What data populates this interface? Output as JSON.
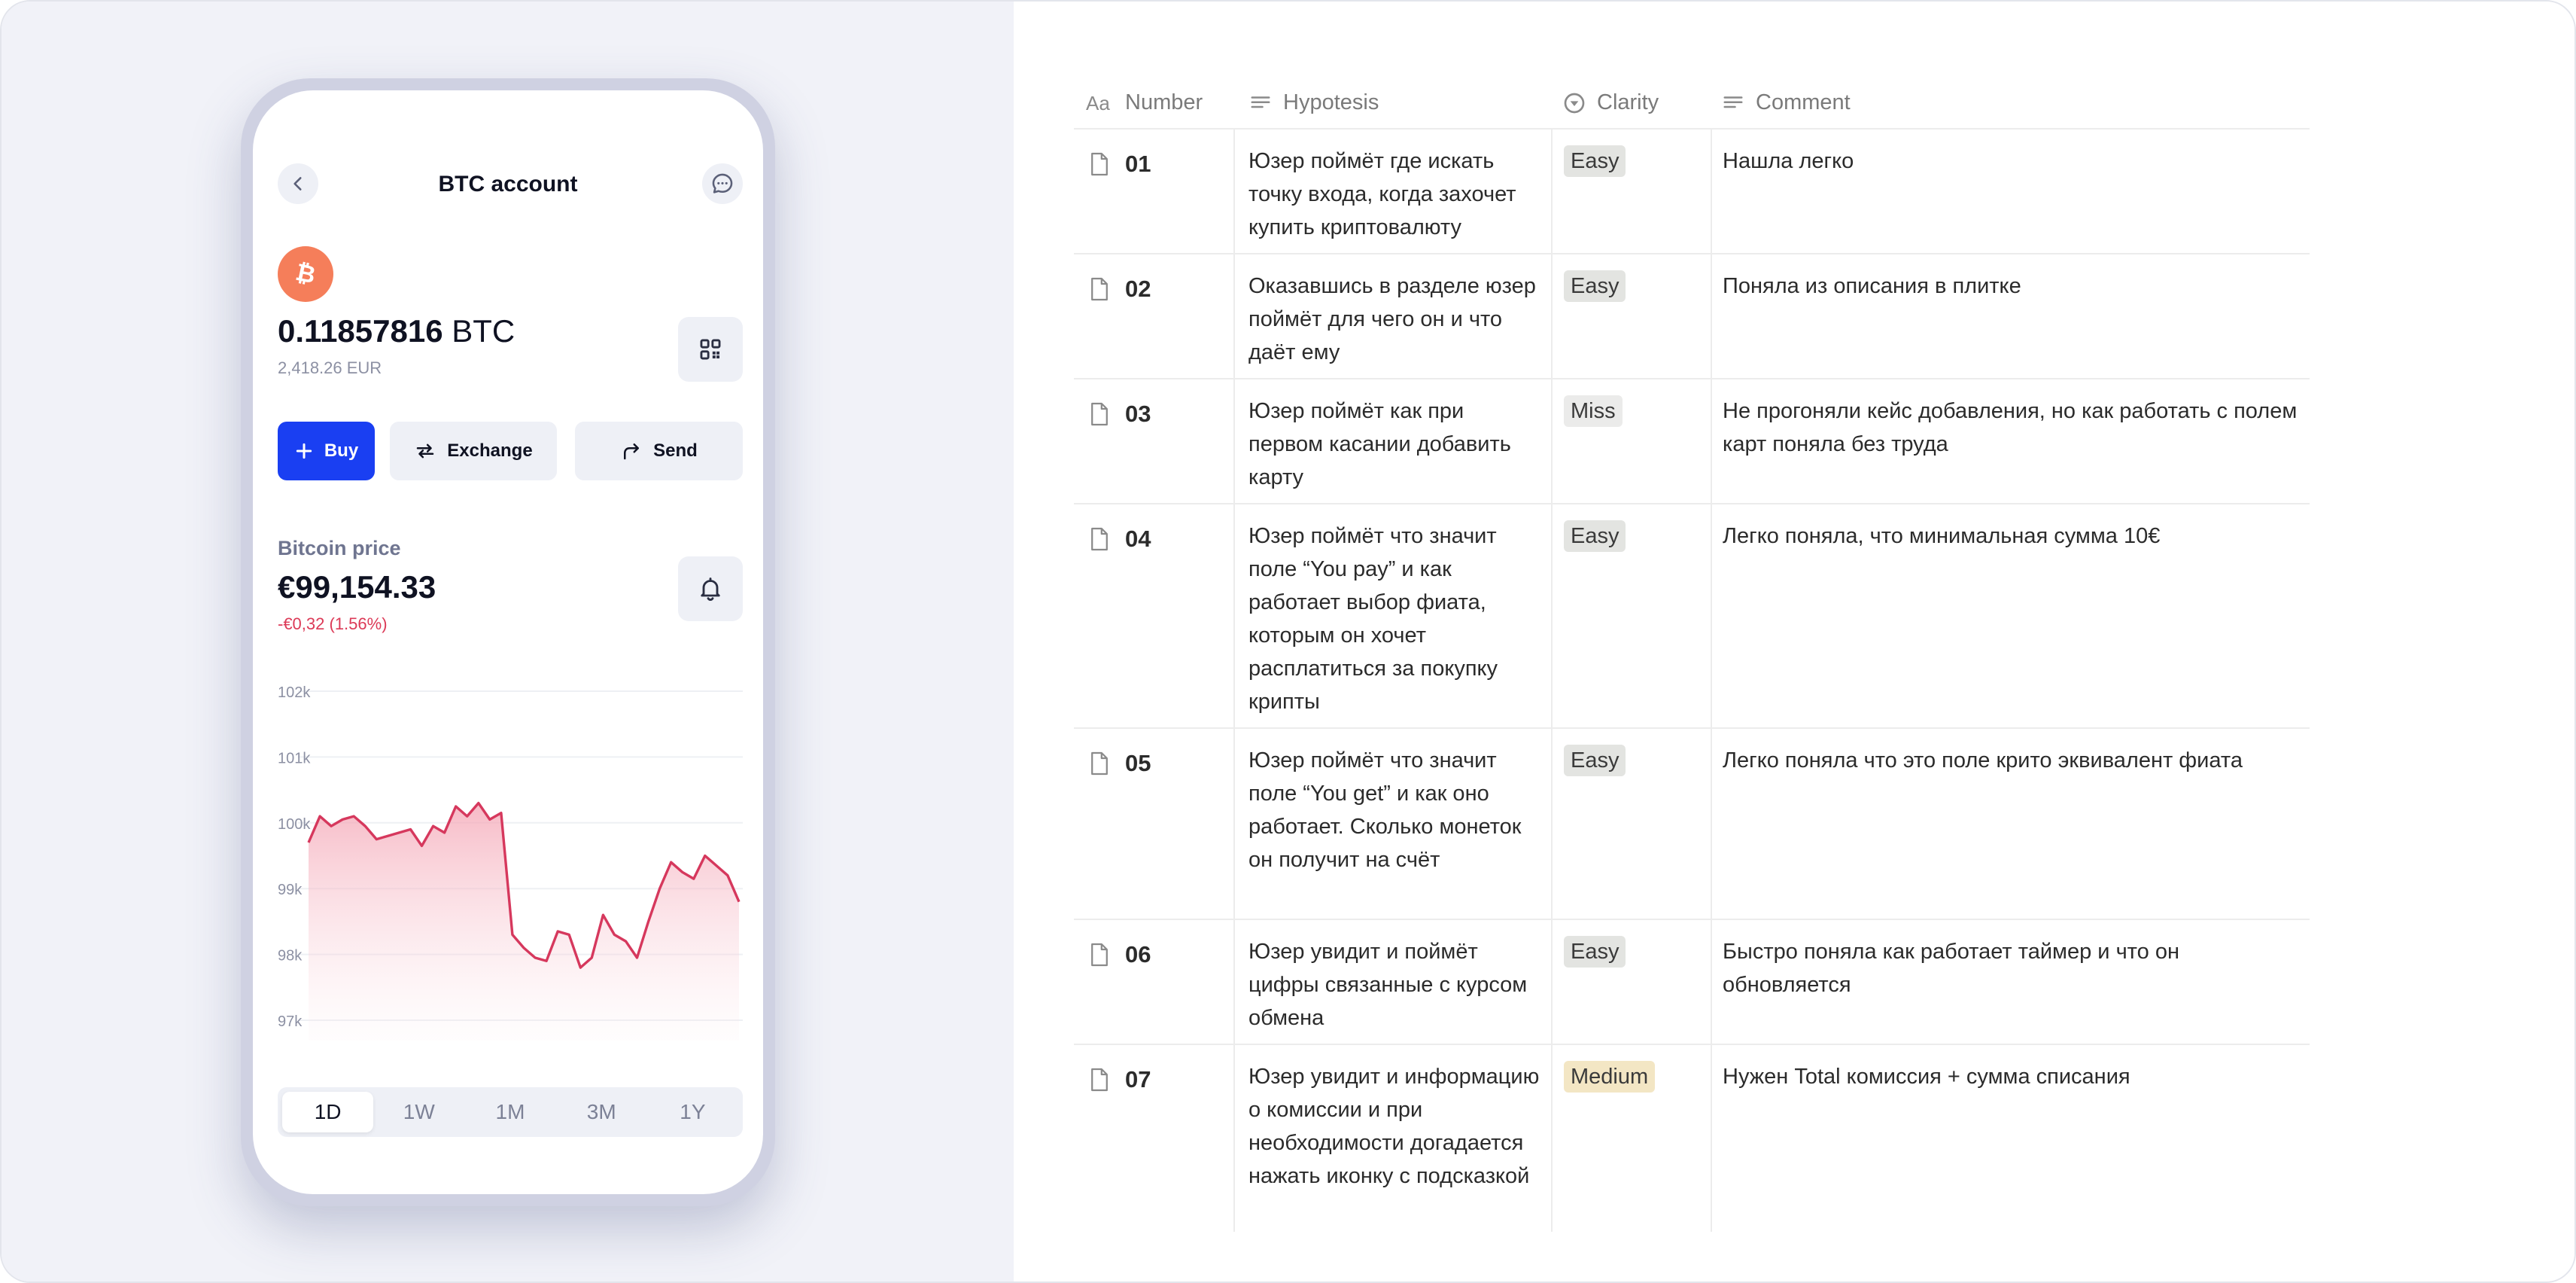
{
  "phone": {
    "title": "BTC account",
    "balance_amount": "0.11857816",
    "balance_currency": "BTC",
    "balance_fiat": "2,418.26 EUR",
    "actions": {
      "buy": "Buy",
      "exchange": "Exchange",
      "send": "Send"
    },
    "price_label": "Bitcoin price",
    "price_value": "€99,154.33",
    "price_change": "-€0,32 (1.56%)",
    "chart_data": {
      "type": "area",
      "y_ticks": [
        "102k",
        "101k",
        "100k",
        "99k",
        "98k",
        "97k"
      ],
      "ylim": [
        96700,
        102000
      ],
      "x": [
        0,
        1,
        2,
        3,
        4,
        5,
        6,
        7,
        8,
        9,
        10,
        11,
        12,
        13,
        14,
        15,
        16,
        17,
        18,
        19,
        20,
        21,
        22,
        23,
        24,
        25,
        26,
        27,
        28,
        29,
        30,
        31,
        32,
        33,
        34,
        35,
        36,
        37,
        38
      ],
      "values": [
        99700,
        100100,
        99950,
        100050,
        100100,
        99950,
        99750,
        99800,
        99850,
        99900,
        99650,
        99950,
        99850,
        100250,
        100100,
        100300,
        100050,
        100150,
        98300,
        98100,
        97950,
        97900,
        98350,
        98300,
        97800,
        97950,
        98600,
        98300,
        98200,
        97950,
        98500,
        99000,
        99400,
        99250,
        99150,
        99500,
        99350,
        99200,
        98800
      ],
      "color": "#d6385d"
    },
    "timeframes": [
      "1D",
      "1W",
      "1M",
      "3M",
      "1Y"
    ],
    "active_timeframe": "1D",
    "colors": {
      "accent": "#1a3ff2",
      "bitcoin": "#f57e5a",
      "negative": "#dc3a57"
    }
  },
  "table": {
    "headers": {
      "number": "Number",
      "hypothesis": "Hypotesis",
      "clarity": "Clarity",
      "comment": "Comment"
    },
    "rows": [
      {
        "number": "01",
        "hypothesis": "Юзер поймёт где искать точку входа, когда захочет купить криптовалюту",
        "clarity": "Easy",
        "comment": "Нашла легко"
      },
      {
        "number": "02",
        "hypothesis": "Оказавшись в разделе юзер поймёт для чего он и что даёт ему",
        "clarity": "Easy",
        "comment": "Поняла из описания в плитке"
      },
      {
        "number": "03",
        "hypothesis": "Юзер поймёт как при первом касании добавить карту",
        "clarity": "Miss",
        "comment": "Не прогоняли кейс добавления, но как работать с полем карт поняла без труда"
      },
      {
        "number": "04",
        "hypothesis": "Юзер поймёт что значит поле “You pay” и как работает выбор фиата, которым он хочет расплатиться за покупку крипты",
        "clarity": "Easy",
        "comment": "Легко поняла, что минимальная сумма 10€"
      },
      {
        "number": "05",
        "hypothesis": "Юзер поймёт что значит поле “You get” и как оно работает. Сколько монеток он получит на счёт",
        "clarity": "Easy",
        "comment": "Легко поняла что это поле крито эквивалент фиата"
      },
      {
        "number": "06",
        "hypothesis": "Юзер увидит и поймёт цифры связанные с курсом обмена",
        "clarity": "Easy",
        "comment": "Быстро поняла как работает таймер и что он обновляется"
      },
      {
        "number": "07",
        "hypothesis": "Юзер увидит и информацию о комиссии и при необходимости догадается нажать иконку с подсказкой",
        "clarity": "Medium",
        "comment": "Нужен Total комиссия + сумма списания"
      }
    ],
    "tag_colors": {
      "Easy": "#e3e4e1",
      "Miss": "#ebebea",
      "Medium": "#f3e6c4"
    }
  }
}
